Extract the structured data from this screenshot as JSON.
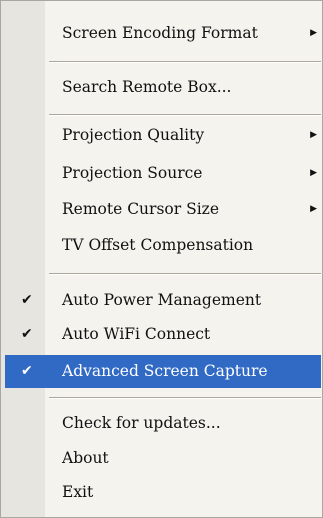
{
  "menu": {
    "items": [
      {
        "label": "Screen Encoding Format",
        "submenu": true
      },
      {
        "label": "Search Remote Box..."
      },
      {
        "label": "Projection Quality",
        "submenu": true
      },
      {
        "label": "Projection Source",
        "submenu": true
      },
      {
        "label": "Remote Cursor Size",
        "submenu": true
      },
      {
        "label": "TV Offset Compensation"
      },
      {
        "label": "Auto Power Management",
        "checked": true,
        "check_glyph": "✔"
      },
      {
        "label": "Auto WiFi Connect",
        "checked": true,
        "check_glyph": "✔"
      },
      {
        "label": "Advanced Screen Capture",
        "checked": true,
        "highlighted": true,
        "check_glyph": "✔"
      },
      {
        "label": "Check for updates..."
      },
      {
        "label": "About"
      },
      {
        "label": "Exit"
      }
    ],
    "submenu_arrow_glyph": "▶",
    "colors": {
      "background": "#f4f3ee",
      "highlight": "#316ac5",
      "highlight_text": "#ffffff",
      "text": "#111111"
    }
  }
}
